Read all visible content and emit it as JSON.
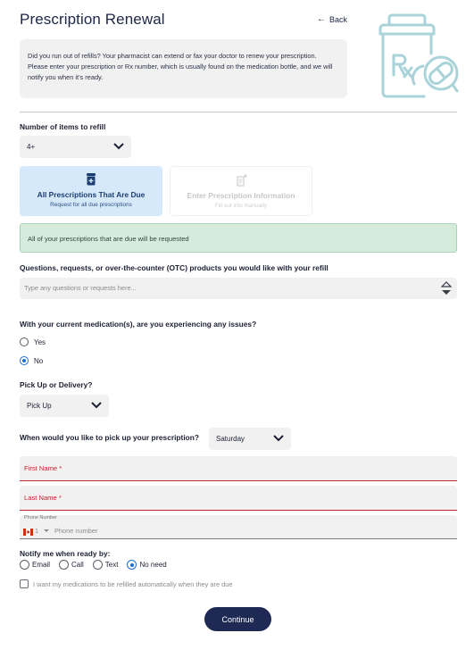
{
  "header": {
    "title": "Prescription Renewal",
    "back_label": "Back"
  },
  "intro": {
    "text": "Did you run out of refills? Your pharmacist can extend or fax your doctor to renew your prescription. Please enter your prescription or Rx number, which is usually found on the medication bottle, and we will notify you when it's ready."
  },
  "items": {
    "label": "Number of items to refill",
    "selected": "4+"
  },
  "mode_cards": [
    {
      "title": "All Prescriptions That Are Due",
      "subtitle": "Request for all due prescriptions",
      "selected": true
    },
    {
      "title": "Enter Prescription Information",
      "subtitle": "Fill out info manually",
      "selected": false
    }
  ],
  "alert": {
    "text": "All of your prescriptions that are due will be requested"
  },
  "questions": {
    "label": "Questions, requests, or over-the-counter (OTC) products you would like with your refill",
    "placeholder": "Type any questions or requests here..."
  },
  "issues": {
    "label": "With your current medication(s), are you experiencing any issues?",
    "options": [
      {
        "label": "Yes",
        "selected": false
      },
      {
        "label": "No",
        "selected": true
      }
    ]
  },
  "pickup": {
    "label": "Pick Up or Delivery?",
    "selected": "Pick Up"
  },
  "pickup_day": {
    "label": "When would you like to pick up your prescription?",
    "selected": "Saturday"
  },
  "contact": {
    "first_name_placeholder": "First Name *",
    "last_name_placeholder": "Last Name *",
    "phone_label": "Phone Number",
    "phone_code": "1",
    "phone_placeholder": "Phone number"
  },
  "notify": {
    "label": "Notify me when ready by:",
    "options": [
      {
        "label": "Email",
        "selected": false
      },
      {
        "label": "Call",
        "selected": false
      },
      {
        "label": "Text",
        "selected": false
      },
      {
        "label": "No need",
        "selected": true
      }
    ]
  },
  "auto_refill": {
    "label": "I want my medications to be refilled automatically when they are due",
    "checked": false
  },
  "actions": {
    "continue_label": "Continue"
  },
  "colors": {
    "primary": "#1f2a54",
    "selected_card": "#d5e9fb",
    "alert_bg": "#d5ecdd",
    "required": "#c0262d",
    "radio": "#1b6fd0"
  }
}
